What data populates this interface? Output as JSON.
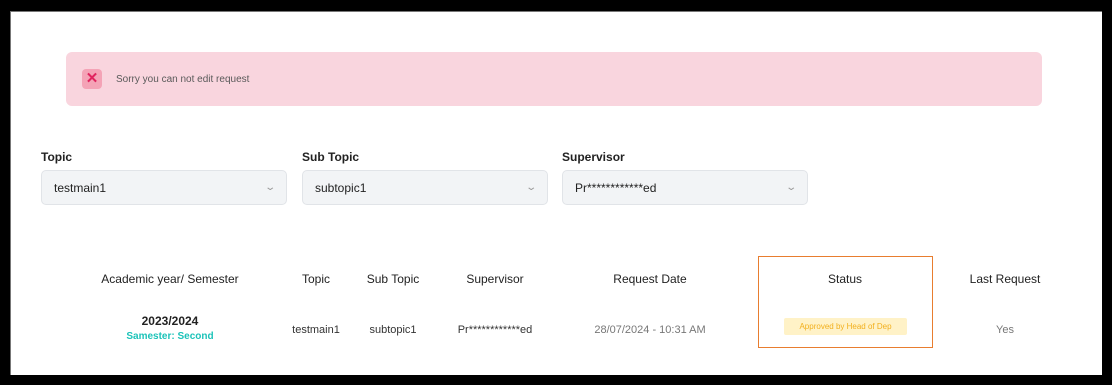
{
  "alert": {
    "icon": "close-icon",
    "message": "Sorry you can not edit request"
  },
  "filters": {
    "topic": {
      "label": "Topic",
      "value": "testmain1"
    },
    "sub_topic": {
      "label": "Sub Topic",
      "value": "subtopic1"
    },
    "supervisor": {
      "label": "Supervisor",
      "value": "Pr************ed"
    }
  },
  "table": {
    "headers": [
      "Academic year/ Semester",
      "Topic",
      "Sub Topic",
      "Supervisor",
      "Request Date",
      "Status",
      "Last Request"
    ],
    "rows": [
      {
        "academic_year": "2023/2024",
        "semester": "Samester: Second",
        "topic": "testmain1",
        "sub_topic": "subtopic1",
        "supervisor": "Pr************ed",
        "request_date": "28/07/2024 - 10:31 AM",
        "status": "Approved by Head of Dep",
        "last_request": "Yes"
      }
    ]
  },
  "colors": {
    "alert_bg": "#f9d5de",
    "alert_icon": "#e0245e",
    "semester_text": "#1cc3b9",
    "status_text": "#f2b01e",
    "status_bg": "#fff2c7",
    "highlight_border": "#e87d2f"
  }
}
